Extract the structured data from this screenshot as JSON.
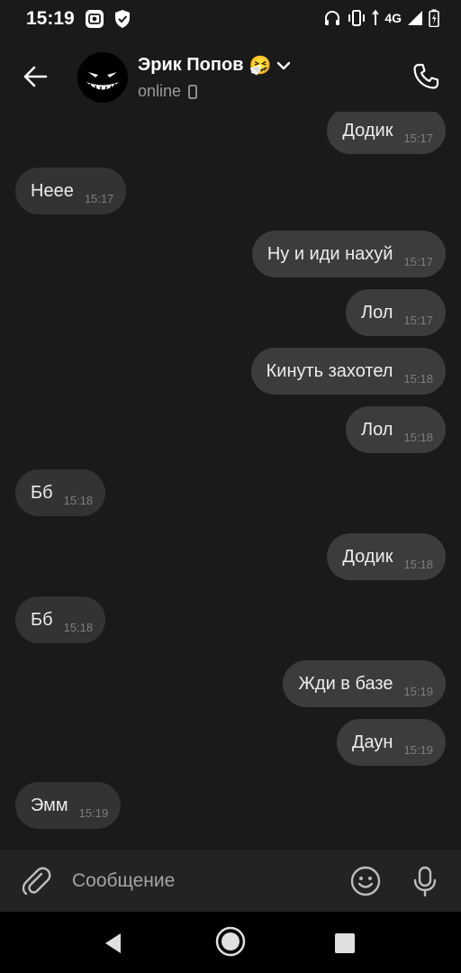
{
  "status_bar": {
    "time": "15:19",
    "network": "4G"
  },
  "header": {
    "contact_name": "Эрик Попов",
    "contact_emoji": "🤧",
    "contact_status": "online"
  },
  "messages": [
    {
      "direction": "out",
      "text": "Додик",
      "time": "15:17"
    },
    {
      "direction": "in",
      "text": "Неее",
      "time": "15:17"
    },
    {
      "direction": "out",
      "text": "Ну и иди нахуй",
      "time": "15:17"
    },
    {
      "direction": "out",
      "text": "Лол",
      "time": "15:17"
    },
    {
      "direction": "out",
      "text": "Кинуть захотел",
      "time": "15:18"
    },
    {
      "direction": "out",
      "text": "Лол",
      "time": "15:18"
    },
    {
      "direction": "in",
      "text": "Бб",
      "time": "15:18"
    },
    {
      "direction": "out",
      "text": "Додик",
      "time": "15:18"
    },
    {
      "direction": "in",
      "text": "Бб",
      "time": "15:18"
    },
    {
      "direction": "out",
      "text": "Жди в базе",
      "time": "15:19"
    },
    {
      "direction": "out",
      "text": "Даун",
      "time": "15:19"
    },
    {
      "direction": "in",
      "text": "Эмм",
      "time": "15:19"
    }
  ],
  "composer": {
    "placeholder": "Сообщение",
    "value": ""
  },
  "colors": {
    "background": "#1a1a1a",
    "bubble_in": "#333333",
    "bubble_out": "#3c3c3c",
    "composer": "#232323",
    "nav_bar": "#000000",
    "muted_text": "#9a9a9a"
  },
  "icons": {
    "back": "arrow-left-icon",
    "call": "phone-icon",
    "attach": "paperclip-icon",
    "emoji": "smiley-icon",
    "mic": "microphone-icon",
    "dropdown": "chevron-down-icon",
    "device": "mobile-device-icon"
  }
}
